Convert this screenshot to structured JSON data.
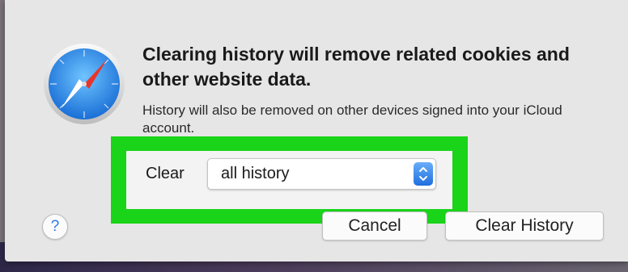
{
  "dialog": {
    "app_icon": "safari-compass-icon",
    "title": "Clearing history will remove related cookies and other website data.",
    "message": "History will also be removed on other devices signed into your iCloud account.",
    "clear_label": "Clear",
    "clear_select": {
      "value": "all history",
      "icon": "up-down-chevron-icon"
    },
    "help_label": "?",
    "buttons": {
      "cancel": "Cancel",
      "clear_history": "Clear History"
    },
    "highlight_color": "#1ad41a",
    "accent_color": "#2c7be5"
  }
}
